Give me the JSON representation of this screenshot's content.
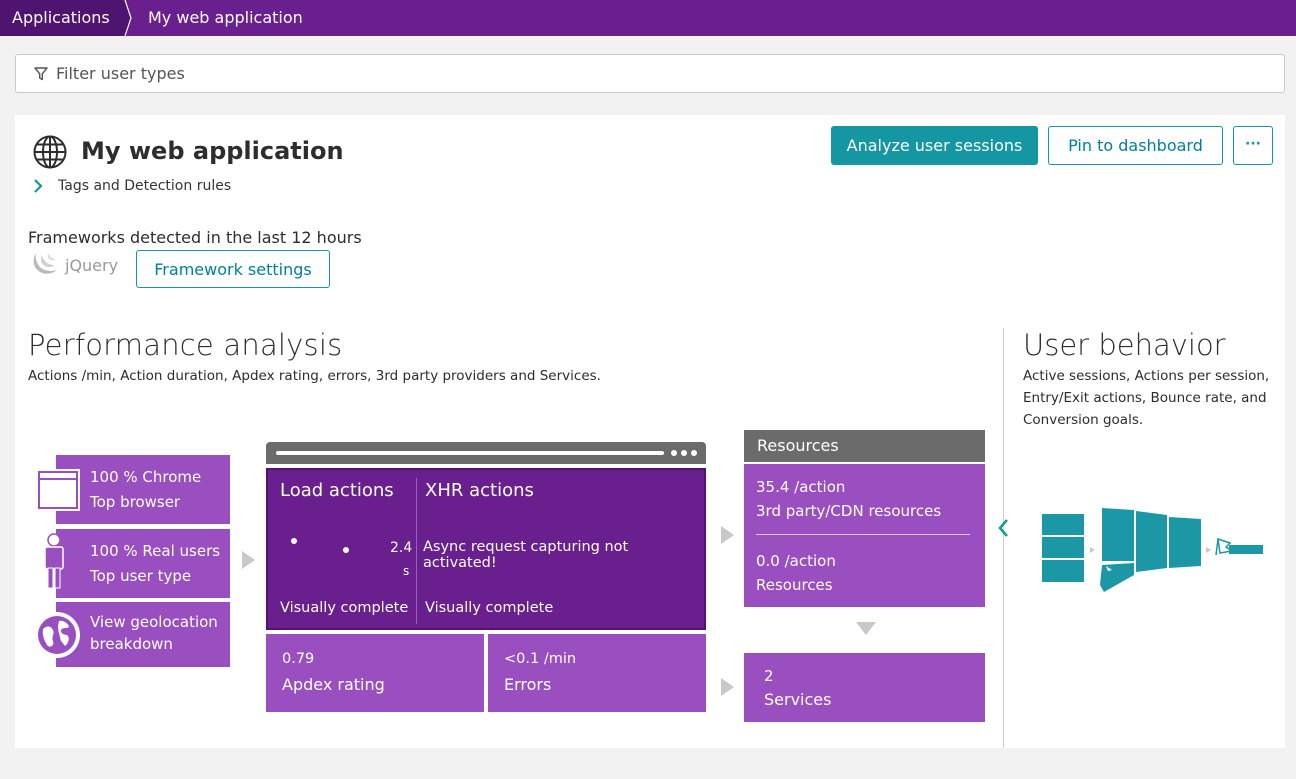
{
  "breadcrumb": {
    "home": "Applications",
    "current": "My web application"
  },
  "filter": {
    "placeholder": "Filter user types"
  },
  "app": {
    "title": "My web application",
    "tags_link": "Tags and Detection rules"
  },
  "actions": {
    "analyze": "Analyze user sessions",
    "pin": "Pin to dashboard",
    "more": "···"
  },
  "frameworks": {
    "heading": "Frameworks detected in the last 12 hours",
    "detected": "jQuery",
    "settings_button": "Framework settings"
  },
  "performance": {
    "title": "Performance analysis",
    "subtitle": "Actions /min, Action duration, Apdex rating, errors, 3rd party providers and Services.",
    "tiles": {
      "browser": {
        "line1": "100 % Chrome",
        "line2": "Top browser"
      },
      "user_type": {
        "line1": "100 % Real users",
        "line2": "Top user type"
      },
      "geo": {
        "line1": "View geolocation",
        "line2": "breakdown"
      }
    },
    "load_actions": {
      "title": "Load actions",
      "value": "2.4",
      "unit": "s",
      "footer": "Visually complete"
    },
    "xhr_actions": {
      "title": "XHR actions",
      "message": "Async request capturing not activated!",
      "footer": "Visually complete"
    },
    "apdex": {
      "value": "0.79",
      "label": "Apdex rating"
    },
    "errors": {
      "value": "<0.1 /min",
      "label": "Errors"
    },
    "resources": {
      "header": "Resources",
      "third_party_value": "35.4 /action",
      "third_party_label": "3rd party/CDN resources",
      "own_value": "0.0 /action",
      "own_label": "Resources"
    },
    "services": {
      "value": "2",
      "label": "Services"
    }
  },
  "user_behavior": {
    "title": "User behavior",
    "subtitle": "Active sessions, Actions per session, Entry/Exit actions, Bounce rate, and Conversion goals."
  },
  "colors": {
    "topbar": "#6a1f8f",
    "primary_button": "#1496a3",
    "tile": "#9a4fc0",
    "actions_box": "#6a1f8f",
    "funnel": "#1b97a6"
  },
  "icons": [
    "filter-icon",
    "globe-icon",
    "chevron-right-icon",
    "jquery-logo",
    "browser-window-icon",
    "person-icon",
    "globe-geo-icon",
    "chevron-left-icon",
    "funnel-graphic",
    "flag-icon"
  ]
}
